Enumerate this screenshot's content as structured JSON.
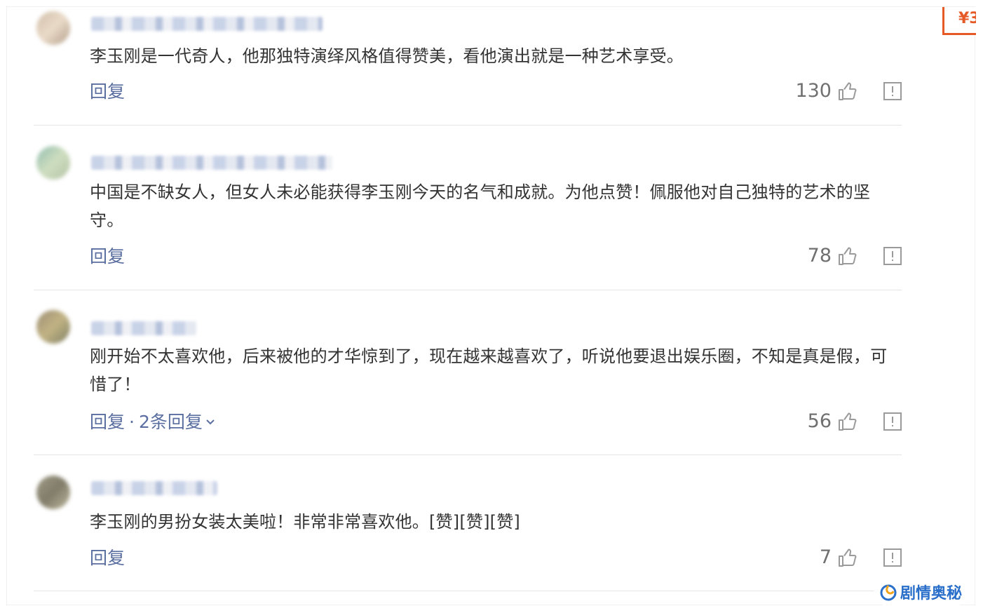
{
  "price_badge": "¥3",
  "watermark": "剧情奥秘",
  "colors": {
    "link": "#5a6ea0",
    "text": "#333333",
    "accent": "#e55a27",
    "watermark": "#2a6fc9"
  },
  "icons": {
    "like": "thumbs-up-icon",
    "report": "report-icon",
    "expand": "chevron-down-icon"
  },
  "comments": [
    {
      "text": "李玉刚是一代奇人，他那独特演绎风格值得赞美，看他演出就是一种艺术享受。",
      "reply_label": "回复",
      "likes": "130"
    },
    {
      "text": "中国是不缺女人，但女人未必能获得李玉刚今天的名气和成就。为他点赞！佩服他对自己独特的艺术的坚守。",
      "reply_label": "回复",
      "likes": "78"
    },
    {
      "text": "刚开始不太喜欢他，后来被他的才华惊到了，现在越来越喜欢了，听说他要退出娱乐圈，不知是真是假，可惜了！",
      "reply_label": "回复",
      "separator": "·",
      "more_replies": "2条回复",
      "likes": "56"
    },
    {
      "text": "李玉刚的男扮女装太美啦！非常非常喜欢他。[赞][赞][赞]",
      "reply_label": "回复",
      "likes": "7"
    }
  ]
}
